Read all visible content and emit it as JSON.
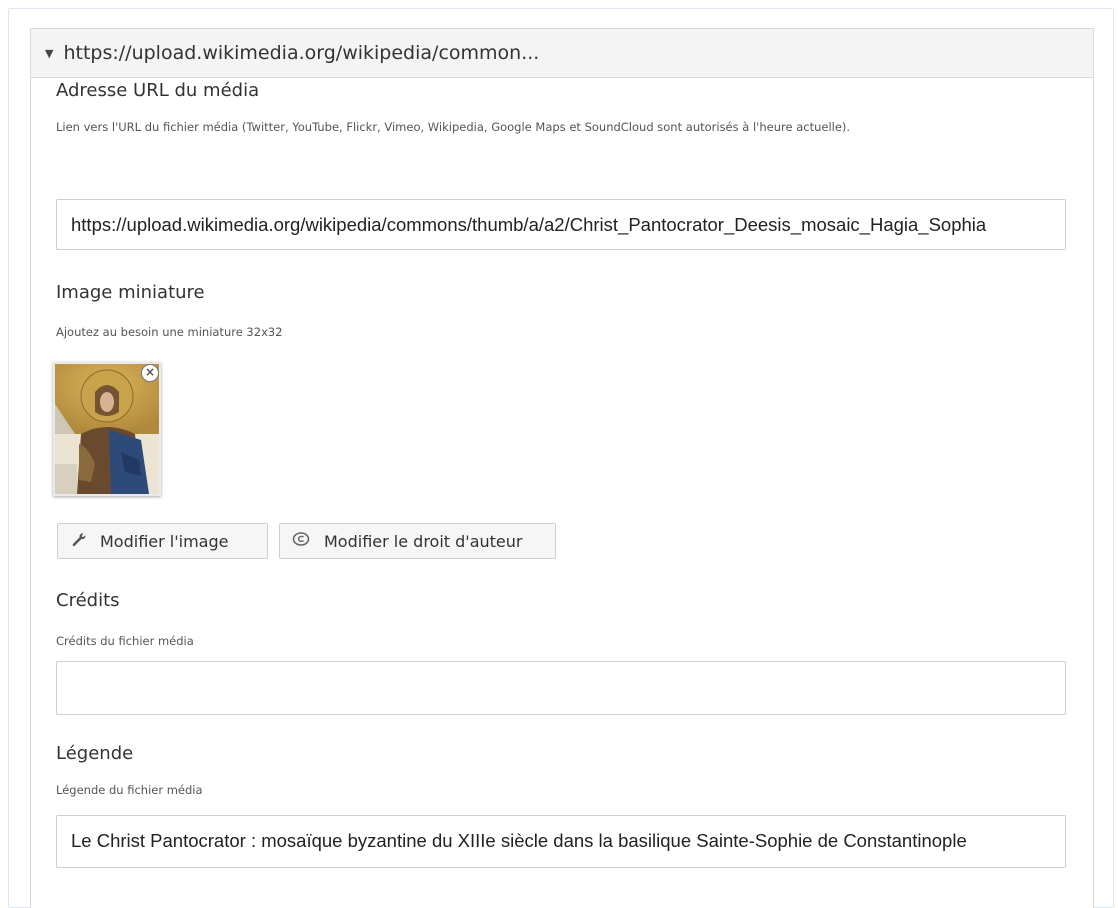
{
  "panel": {
    "header_title": "https://upload.wikimedia.org/wikipedia/common...",
    "caret_icon": "caret-down-icon"
  },
  "url_section": {
    "label": "Adresse URL du média",
    "help": "Lien vers l'URL du fichier média (Twitter, YouTube, Flickr, Vimeo, Wikipedia, Google Maps et SoundCloud sont autorisés à l'heure actuelle).",
    "value": "https://upload.wikimedia.org/wikipedia/commons/thumb/a/a2/Christ_Pantocrator_Deesis_mosaic_Hagia_Sophia"
  },
  "image_section": {
    "label": "Image miniature",
    "help": "Ajoutez au besoin une miniature 32x32",
    "remove_icon": "close-icon",
    "remove_glyph": "×"
  },
  "buttons": {
    "edit_image": "Modifier l'image",
    "edit_image_icon": "wrench-icon",
    "edit_copyright": "Modifier le droit d'auteur",
    "edit_copyright_icon": "copyright-icon"
  },
  "credits_section": {
    "label": "Crédits",
    "help": "Crédits du fichier média",
    "value": ""
  },
  "caption_section": {
    "label": "Légende",
    "help": "Légende du fichier média",
    "value": "Le Christ Pantocrator : mosaïque byzantine du XIIIe siècle dans la basilique Sainte-Sophie de Constantinople"
  }
}
